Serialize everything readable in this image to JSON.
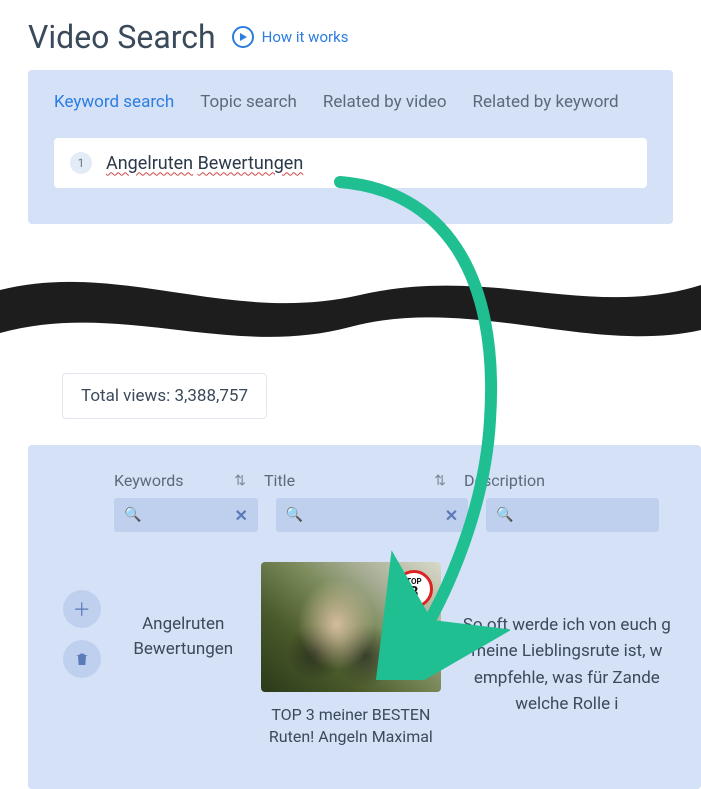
{
  "header": {
    "title": "Video Search",
    "how_link": "How it works"
  },
  "tabs": {
    "keyword": "Keyword search",
    "topic": "Topic search",
    "related_video": "Related by video",
    "related_keyword": "Related by keyword"
  },
  "search": {
    "index": "1",
    "term1": "Angelruten",
    "term2": "Bewertungen"
  },
  "totals": {
    "label": "Total views: ",
    "value": "3,388,757"
  },
  "columns": {
    "keywords": "Keywords",
    "title": "Title",
    "description": "Description"
  },
  "result": {
    "keyword_line1": "Angelruten",
    "keyword_line2": "Bewertungen",
    "top_badge_label": "TOP",
    "top_badge_num": "3",
    "video_title": "TOP 3 meiner BESTEN Ruten! Angeln Maximal",
    "description": "So oft werde ich von euch g meine Lieblingsrute ist, w empfehle, was für Zande welche Rolle i"
  }
}
